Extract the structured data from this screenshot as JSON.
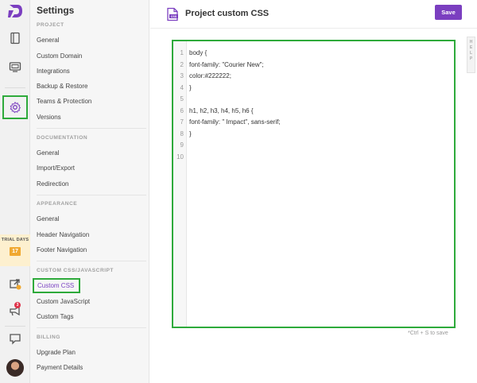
{
  "sidebar": {
    "title": "Settings",
    "sections": [
      {
        "label": "PROJECT",
        "items": [
          "General",
          "Custom Domain",
          "Integrations",
          "Backup & Restore",
          "Teams & Protection",
          "Versions"
        ]
      },
      {
        "label": "DOCUMENTATION",
        "items": [
          "General",
          "Import/Export",
          "Redirection"
        ]
      },
      {
        "label": "APPEARANCE",
        "items": [
          "General",
          "Header Navigation",
          "Footer Navigation"
        ]
      },
      {
        "label": "CUSTOM CSS/JAVASCRIPT",
        "items": [
          "Custom CSS",
          "Custom JavaScript",
          "Custom Tags"
        ]
      },
      {
        "label": "BILLING",
        "items": [
          "Upgrade Plan",
          "Payment Details"
        ]
      }
    ],
    "active_item": "Custom CSS"
  },
  "rail": {
    "trial_label": "TRIAL DAYS",
    "trial_days": "17",
    "notification_count": "3",
    "icons": [
      "logo-icon",
      "documentation-icon",
      "preview-icon",
      "settings-icon",
      "external-link-icon",
      "announcement-icon",
      "chat-icon"
    ]
  },
  "header": {
    "title": "Project custom CSS",
    "save_label": "Save",
    "help_label": "HELP"
  },
  "editor": {
    "lines": [
      {
        "n": "1",
        "text": "body {"
      },
      {
        "n": "2",
        "text": "font-family: \"Courier New\";"
      },
      {
        "n": "3",
        "text": "color:#222222;"
      },
      {
        "n": "4",
        "text": "}"
      },
      {
        "n": "5",
        "text": ""
      },
      {
        "n": "6",
        "text": "h1, h2, h3, h4, h5, h6 {"
      },
      {
        "n": "7",
        "text": "font-family: \" Impact\", sans-serif;"
      },
      {
        "n": "8",
        "text": "}"
      },
      {
        "n": "9",
        "text": ""
      },
      {
        "n": "10",
        "text": ""
      }
    ],
    "save_hint": "*Ctrl + S to save"
  },
  "colors": {
    "accent": "#7b3fc0",
    "highlight_border": "#2eaa3b",
    "trial_badge": "#f0a830"
  }
}
